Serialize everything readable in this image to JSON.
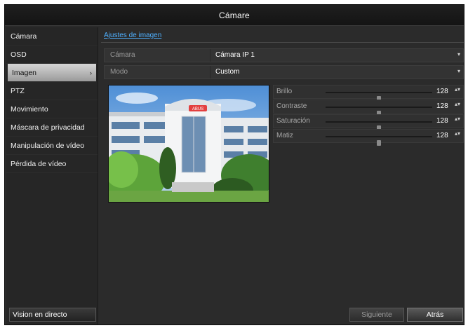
{
  "window": {
    "title": "Cámare"
  },
  "sidebar": {
    "items": [
      {
        "label": "Cámara",
        "active": false
      },
      {
        "label": "OSD",
        "active": false
      },
      {
        "label": "Imagen",
        "active": true
      },
      {
        "label": "PTZ",
        "active": false
      },
      {
        "label": "Movimiento",
        "active": false
      },
      {
        "label": "Máscara de privacidad",
        "active": false
      },
      {
        "label": "Manipulación de vídeo",
        "active": false
      },
      {
        "label": "Pérdida de vídeo",
        "active": false
      }
    ],
    "active_chevron": "›",
    "live_button": "Vision en directo"
  },
  "main": {
    "tab": "Ajustes de imagen",
    "fields": [
      {
        "label": "Cámara",
        "value": "Cámara IP 1",
        "arrow": "▾"
      },
      {
        "label": "Modo",
        "value": "Custom",
        "arrow": "▾"
      }
    ],
    "adjustments": [
      {
        "label": "Brillo",
        "value": "128",
        "level": 0.5
      },
      {
        "label": "Contraste",
        "value": "128",
        "level": 0.5
      },
      {
        "label": "Saturación",
        "value": "128",
        "level": 0.5
      },
      {
        "label": "Matiz",
        "value": "128",
        "level": 0.5
      }
    ],
    "spin_symbol": "▴▾",
    "preview": {
      "sign_text": "ABUS"
    }
  },
  "footer": {
    "next_label": "Siguiente",
    "back_label": "Atrás"
  }
}
